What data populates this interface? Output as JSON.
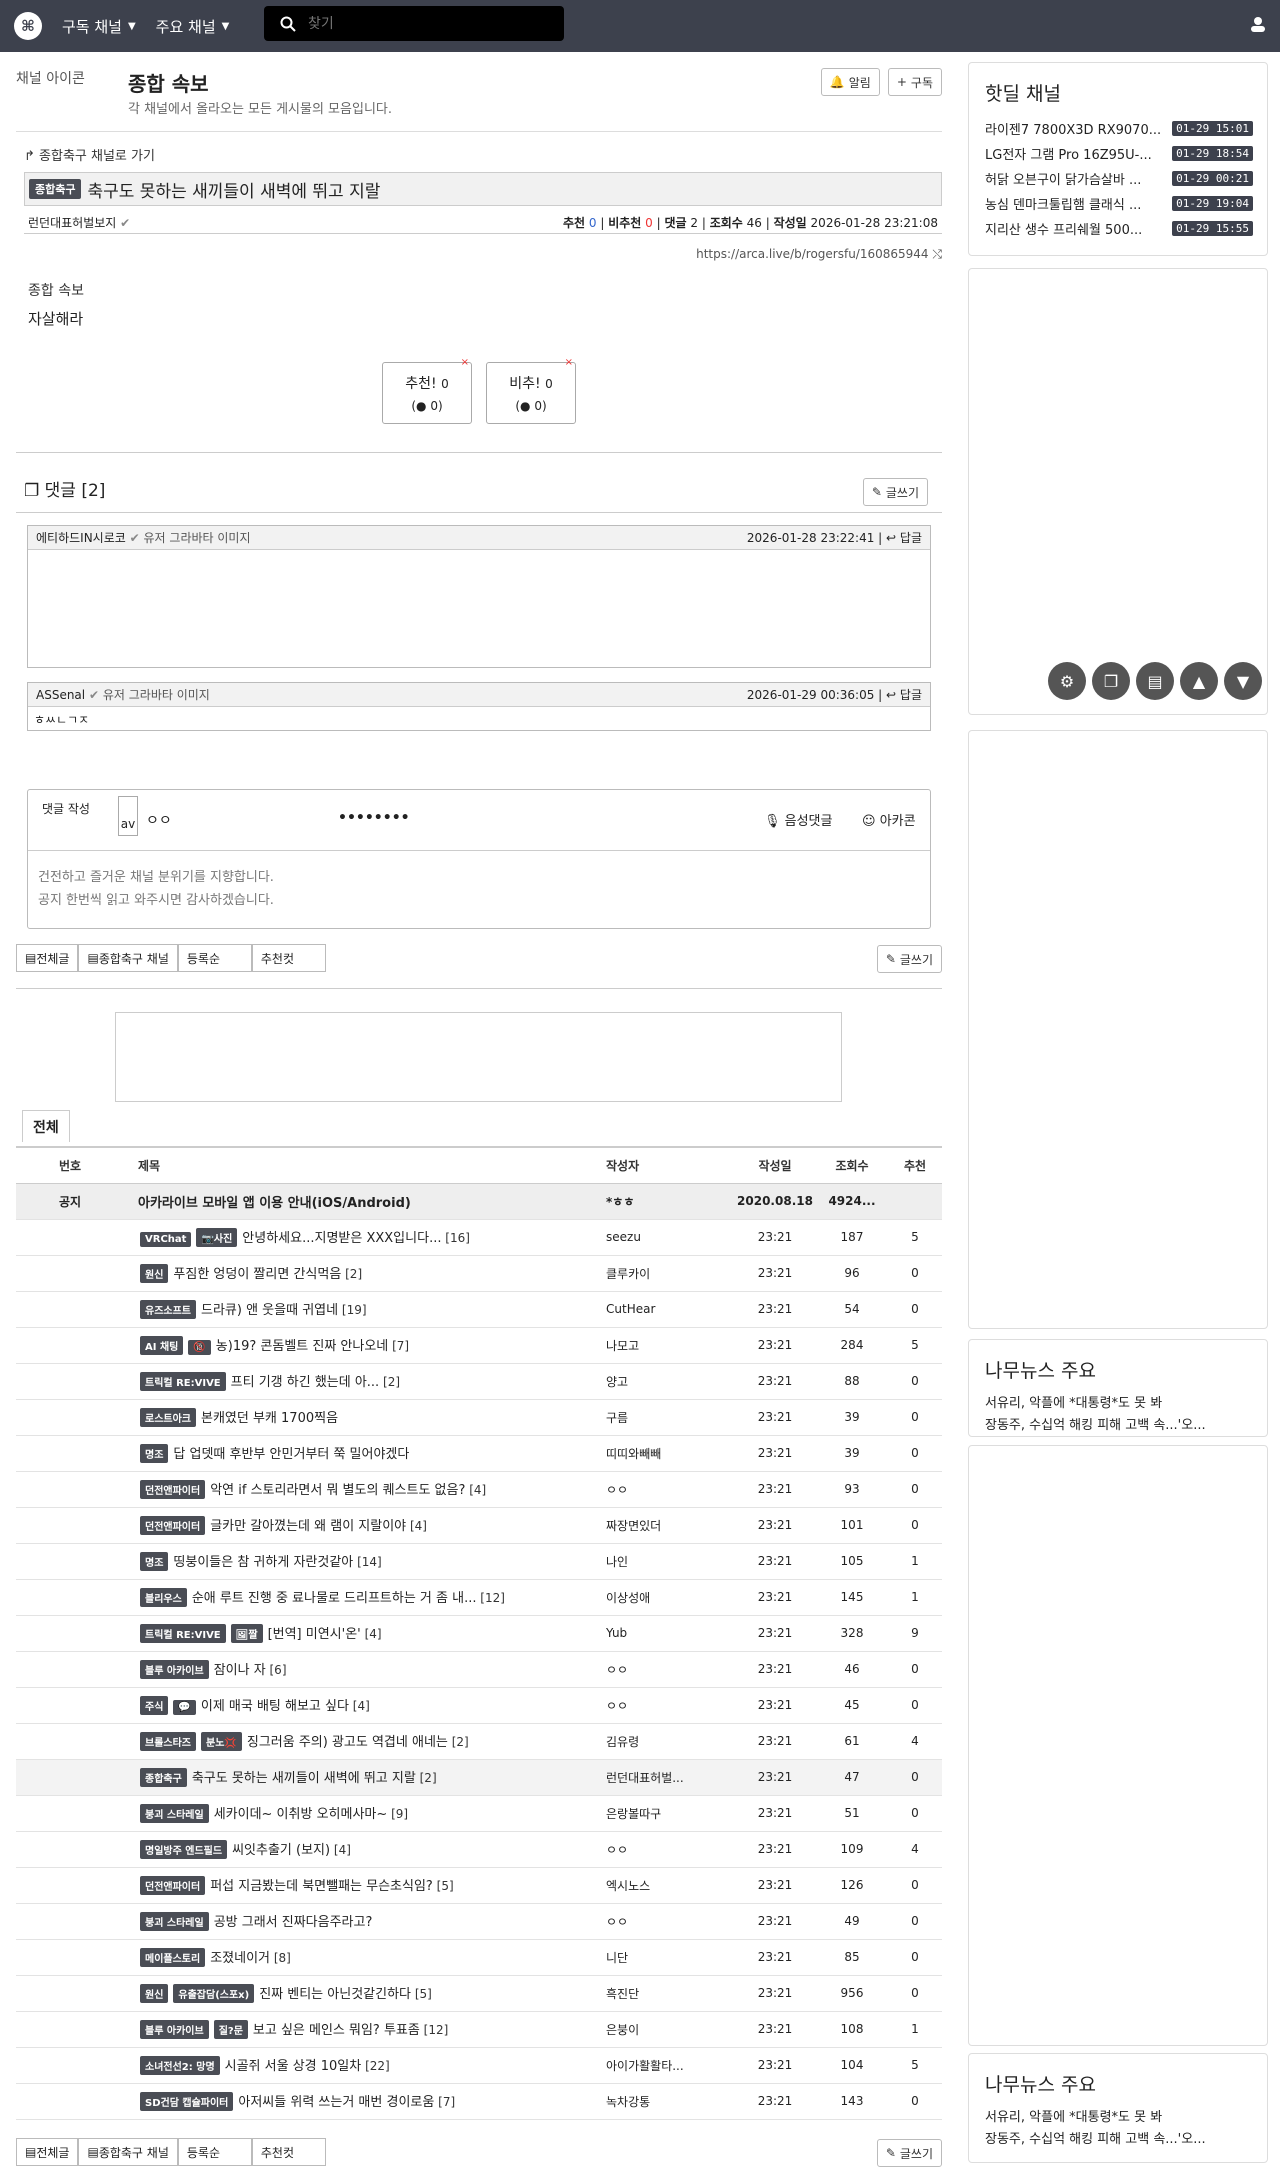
{
  "topbar": {
    "subscribed": "구독 채널",
    "main": "주요 채널",
    "search_placeholder": "찾기"
  },
  "channel": {
    "img_alt": "채널 아이콘",
    "title": "종합 속보",
    "desc": "각 채널에서 올라오는 모든 게시물의 모음입니다.",
    "alarm": "알림",
    "subscribe": "구독"
  },
  "article": {
    "goto": "종합축구 채널로 가기",
    "category": "종합축구",
    "title": "축구도 못하는 새끼들이 새벽에 뛰고 지랄",
    "author": "런던대표허벌보지",
    "rec_label": "추천",
    "rec": "0",
    "unrec_label": "비추천",
    "unrec": "0",
    "cmt_label": "댓글",
    "cmt": "2",
    "views_label": "조회수",
    "views": "46",
    "date_label": "작성일",
    "date": "2026-01-28 23:21:08",
    "url": "https://arca.live/b/rogersfu/160865944",
    "img_alt": "종합 속보",
    "body": "자살해라"
  },
  "vote": {
    "up": "추천!",
    "up_n": "0",
    "up_s": "0",
    "down": "비추!",
    "down_n": "0",
    "down_s": "0"
  },
  "comments": {
    "title": "댓글 [2]",
    "write": "글쓰기",
    "reply": "답글",
    "avatar_alt": "유저 그라바타 이미지",
    "items": [
      {
        "author": "에티하드IN시로코",
        "date": "2026-01-28 23:22:41",
        "text": ""
      },
      {
        "author": "ASSenal",
        "date": "2026-01-29 00:36:05",
        "text": "ㅎㅆㄴㄱㅈ"
      }
    ]
  },
  "write": {
    "label": "댓글 작성",
    "avatar": "av",
    "nick": "ㅇㅇ",
    "pw": "••••••••",
    "voice": "음성댓글",
    "emoticon": "아카콘",
    "placeholder_1": "건전하고 즐거운 채널 분위기를 지향합니다.",
    "placeholder_2": "공지 한번씩 읽고 와주시면 감사하겠습니다."
  },
  "tabs": {
    "all": "전체글",
    "channel": "종합축구 채널",
    "order": "등록순",
    "rec": "추천컷",
    "write": "글쓰기"
  },
  "list": {
    "tab": "전체",
    "headers": [
      "번호",
      "제목",
      "작성자",
      "작성일",
      "조회수",
      "추천"
    ],
    "notice": {
      "no": "공지",
      "title": "아카라이브 모바일 앱 이용 안내(iOS/Android)",
      "author": "*ㅎㅎ",
      "date": "2020.08.18",
      "views": "4924...",
      "rec": ""
    },
    "rows": [
      {
        "b1": "VRChat",
        "b2": "📷사진",
        "title": "안녕하세요...지명받은 XXX입니다...",
        "c": "[16]",
        "author": "seezu",
        "time": "23:21",
        "views": "187",
        "rec": "5"
      },
      {
        "b1": "원신",
        "b2": "",
        "title": "푸짐한 엉덩이 짤리면 간식먹음",
        "c": "[2]",
        "author": "클루카이",
        "time": "23:21",
        "views": "96",
        "rec": "0"
      },
      {
        "b1": "유즈소프트",
        "b2": "",
        "title": "드라큐) 앤 웃을때 귀엽네",
        "c": "[19]",
        "author": "CutHear",
        "time": "23:21",
        "views": "54",
        "rec": "0"
      },
      {
        "b1": "AI 채팅",
        "b2": "🔞",
        "title": "농)19? 콘돔벨트 진짜 안나오네",
        "c": "[7]",
        "author": "나모고",
        "time": "23:21",
        "views": "284",
        "rec": "5"
      },
      {
        "b1": "트릭컬 RE:VIVE",
        "b2": "",
        "title": "프티 기갱 하긴 했는데 아...",
        "c": "[2]",
        "author": "양고",
        "time": "23:21",
        "views": "88",
        "rec": "0"
      },
      {
        "b1": "로스트아크",
        "b2": "",
        "title": "본캐였던 부캐 1700찍음",
        "c": "",
        "author": "구름",
        "time": "23:21",
        "views": "39",
        "rec": "0"
      },
      {
        "b1": "명조",
        "b2": "",
        "title": "답 업뎃때 후반부 안민거부터 쭉 밀어야겠다",
        "c": "",
        "author": "띠띠와빼빼",
        "time": "23:21",
        "views": "39",
        "rec": "0"
      },
      {
        "b1": "던전앤파이터",
        "b2": "",
        "title": "악연 if 스토리라면서 뭐 별도의 퀘스트도 없음?",
        "c": "[4]",
        "author": "ㅇㅇ",
        "time": "23:21",
        "views": "93",
        "rec": "0"
      },
      {
        "b1": "던전앤파이터",
        "b2": "",
        "title": "글카만 갈아꼈는데 왜 램이 지랄이야",
        "c": "[4]",
        "author": "짜장면있더",
        "time": "23:21",
        "views": "101",
        "rec": "0"
      },
      {
        "b1": "명조",
        "b2": "",
        "title": "띵붕이들은 참 귀하게 자란것같아",
        "c": "[14]",
        "author": "나인",
        "time": "23:21",
        "views": "105",
        "rec": "1"
      },
      {
        "b1": "블리우스",
        "b2": "",
        "title": "순애 루트 진행 중 료나물로 드리프트하는 거 좀 내...",
        "c": "[12]",
        "author": "이상성애",
        "time": "23:21",
        "views": "145",
        "rec": "1"
      },
      {
        "b1": "트릭컬 RE:VIVE",
        "b2": "🖼짤",
        "title": "[번역] 미연시'온'",
        "c": "[4]",
        "author": "Yub",
        "time": "23:21",
        "views": "328",
        "rec": "9"
      },
      {
        "b1": "블루 아카이브",
        "b2": "",
        "title": "잠이나 자",
        "c": "[6]",
        "author": "ㅇㅇ",
        "time": "23:21",
        "views": "46",
        "rec": "0"
      },
      {
        "b1": "주식",
        "b2": "💬",
        "title": "이제 매국 배팅 해보고 싶다",
        "c": "[4]",
        "author": "ㅇㅇ",
        "time": "23:21",
        "views": "45",
        "rec": "0"
      },
      {
        "b1": "브롤스타즈",
        "b2": "분노💢",
        "title": "징그러움 주의) 광고도 역겹네 애네는",
        "c": "[2]",
        "author": "김유령",
        "time": "23:21",
        "views": "61",
        "rec": "4"
      },
      {
        "b1": "종합축구",
        "b2": "",
        "title": "축구도 못하는 새끼들이 새벽에 뛰고 지랄",
        "c": "[2]",
        "author": "런던대표허벌...",
        "time": "23:21",
        "views": "47",
        "rec": "0"
      },
      {
        "b1": "붕괴 스타레일",
        "b2": "",
        "title": "세카이데~ 이취방 오히메사마~",
        "c": "[9]",
        "author": "은랑볼따구",
        "time": "23:21",
        "views": "51",
        "rec": "0"
      },
      {
        "b1": "명일방주 엔드필드",
        "b2": "",
        "title": "씨잇추출기 (보지)",
        "c": "[4]",
        "author": "ㅇㅇ",
        "time": "23:21",
        "views": "109",
        "rec": "4"
      },
      {
        "b1": "던전앤파이터",
        "b2": "",
        "title": "퍼섭 지금봤는데 북면뺄패는 무슨초식임?",
        "c": "[5]",
        "author": "엑시노스",
        "time": "23:21",
        "views": "126",
        "rec": "0"
      },
      {
        "b1": "붕괴 스타레일",
        "b2": "",
        "title": "공방 그래서 진짜다음주라고?",
        "c": "",
        "author": "ㅇㅇ",
        "time": "23:21",
        "views": "49",
        "rec": "0"
      },
      {
        "b1": "메이플스토리",
        "b2": "",
        "title": "조졌네이거",
        "c": "[8]",
        "author": "니단",
        "time": "23:21",
        "views": "85",
        "rec": "0"
      },
      {
        "b1": "원신",
        "b2": "유출잡담(스포x)",
        "title": "진짜 벤티는 아닌것같긴하다",
        "c": "[5]",
        "author": "흑진단",
        "time": "23:21",
        "views": "956",
        "rec": "0"
      },
      {
        "b1": "블루 아카이브",
        "b2": "질?문",
        "title": "보고 싶은 메인스 뭐임? 투표좀",
        "c": "[12]",
        "author": "은붕이",
        "time": "23:21",
        "views": "108",
        "rec": "1"
      },
      {
        "b1": "소녀전선2: 망명",
        "b2": "",
        "title": "시골쥐 서울 상경 10일차",
        "c": "[22]",
        "author": "아이가활활타...",
        "time": "23:21",
        "views": "104",
        "rec": "5"
      },
      {
        "b1": "SD건담 캡슐파이터",
        "b2": "",
        "title": "아저씨들 위력 쓰는거 매번 경이로움",
        "c": "[7]",
        "author": "녹차강통",
        "time": "23:21",
        "views": "143",
        "rec": "0"
      }
    ]
  },
  "side": {
    "hot_title": "핫딜 채널",
    "hot": [
      {
        "t": "라이젠7 7800X3D RX9070...",
        "ts": "01-29 15:01"
      },
      {
        "t": "LG전자 그램 Pro 16Z95U-...",
        "ts": "01-29 18:54"
      },
      {
        "t": "허닭 오븐구이 닭가슴살바 ...",
        "ts": "01-29 00:21"
      },
      {
        "t": "농심 덴마크툴립햄 클래식 ...",
        "ts": "01-29 19:04"
      },
      {
        "t": "지리산 생수 프리쉐월 500...",
        "ts": "01-29 15:55"
      }
    ],
    "news_title": "나무뉴스 주요",
    "news_text_1": "서유리, 악플에 *대통령*도 못 봐",
    "news_text_2": "장동주, 수십억 해킹 피해 고백 속...'오...",
    "news2_title": "나무뉴스 주요",
    "news2_text_1": "서유리, 악플에 *대통령*도 못 봐",
    "news2_text_2": "장동주, 수십억 해킹 피해 고백 속...'오..."
  }
}
